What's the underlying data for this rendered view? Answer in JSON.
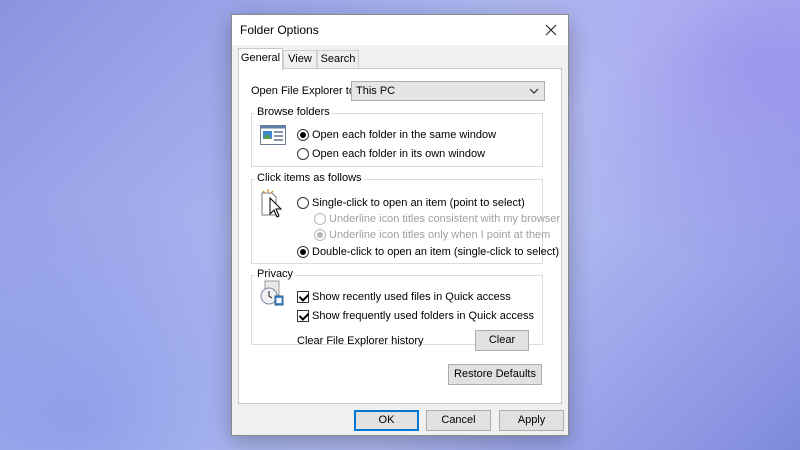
{
  "window": {
    "title": "Folder Options"
  },
  "tabs": [
    {
      "label": "General",
      "active": true
    },
    {
      "label": "View",
      "active": false
    },
    {
      "label": "Search",
      "active": false
    }
  ],
  "general": {
    "open_explorer_label": "Open File Explorer to:",
    "open_explorer_value": "This PC",
    "browse_folders": {
      "label": "Browse folders",
      "options": [
        {
          "label": "Open each folder in the same window",
          "checked": true
        },
        {
          "label": "Open each folder in its own window",
          "checked": false
        }
      ]
    },
    "click_items": {
      "label": "Click items as follows",
      "single_click": {
        "label": "Single-click to open an item (point to select)",
        "checked": false
      },
      "underline_consistent": {
        "label": "Underline icon titles consistent with my browser",
        "checked": false,
        "disabled": true
      },
      "underline_point": {
        "label": "Underline icon titles only when I point at them",
        "checked": true,
        "disabled": true
      },
      "double_click": {
        "label": "Double-click to open an item (single-click to select)",
        "checked": true
      }
    },
    "privacy": {
      "label": "Privacy",
      "show_recent_files": {
        "label": "Show recently used files in Quick access",
        "checked": true
      },
      "show_frequent_folders": {
        "label": "Show frequently used folders in Quick access",
        "checked": true
      },
      "clear_history_label": "Clear File Explorer history",
      "clear_button": "Clear"
    },
    "restore_defaults_button": "Restore Defaults"
  },
  "footer": {
    "ok": "OK",
    "cancel": "Cancel",
    "apply": "Apply"
  },
  "icons": {
    "close": "close-icon",
    "dropdown": "chevron-down-icon",
    "browse": "folder-window-icon",
    "click": "cursor-click-icon",
    "privacy": "privacy-clock-icon"
  },
  "colors": {
    "accent": "#0078d7",
    "disabled_text": "#a0a0a0"
  }
}
